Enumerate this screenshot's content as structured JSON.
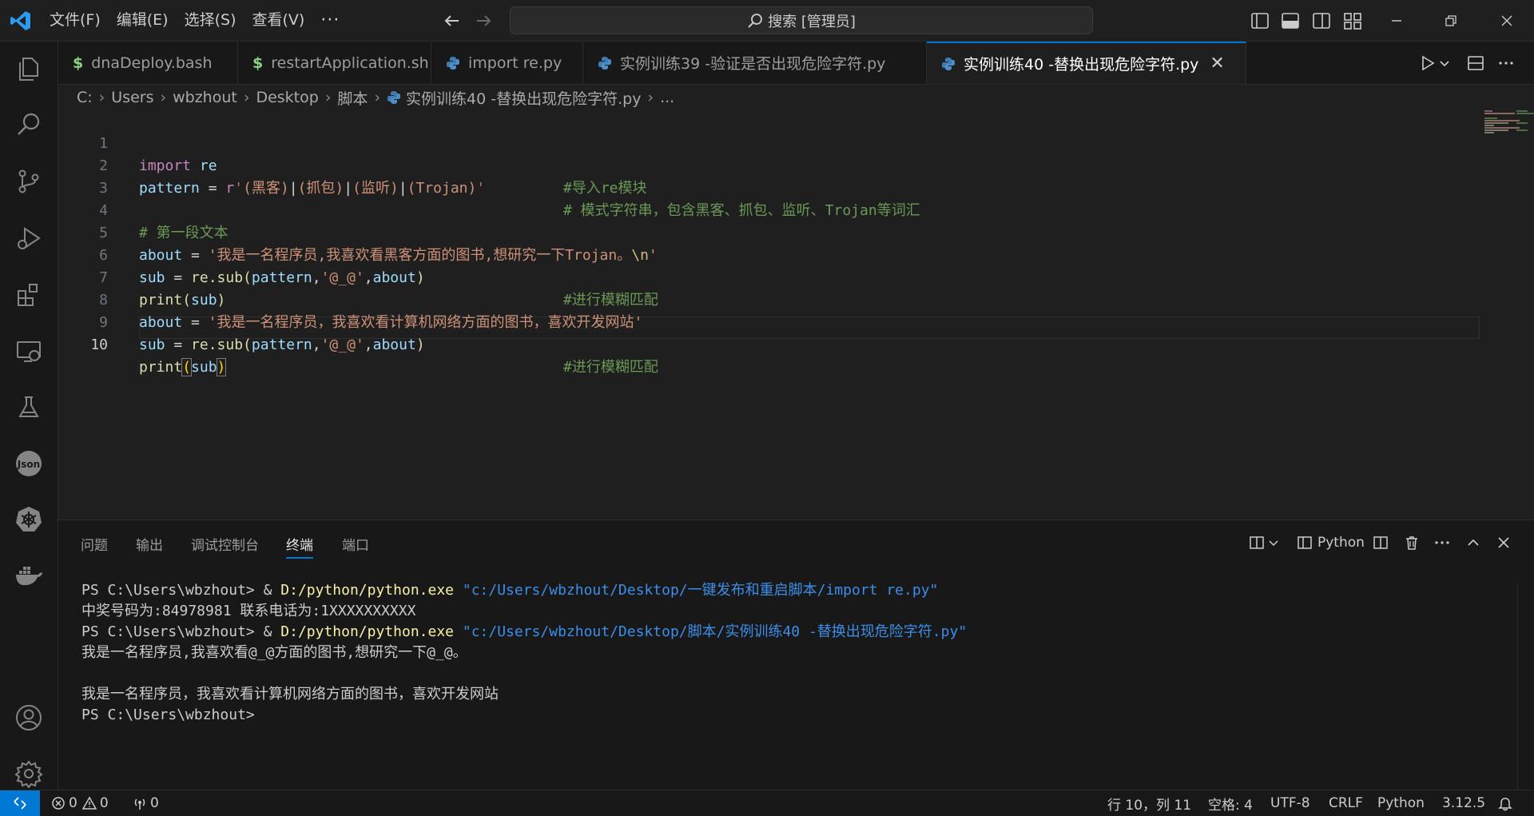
{
  "menu": [
    "文件(F)",
    "编辑(E)",
    "选择(S)",
    "查看(V)",
    "···"
  ],
  "search": {
    "label": "搜索 [管理员]"
  },
  "tabs": [
    {
      "label": "dnaDeploy.bash",
      "icon": "$"
    },
    {
      "label": "restartApplication.sh",
      "icon": "$"
    },
    {
      "label": "import re.py",
      "icon": "python-icon"
    },
    {
      "label": "实例训练39 -验证是否出现危险字符.py",
      "icon": "python-icon"
    },
    {
      "label": "实例训练40 -替换出现危险字符.py",
      "icon": "python-icon",
      "active": true,
      "close": "✕"
    }
  ],
  "breadcrumb": [
    "C:",
    "Users",
    "wbzhout",
    "Desktop",
    "脚本",
    "实例训练40 -替换出现危险字符.py",
    "..."
  ],
  "breadcrumb_sep": "›",
  "editor": {
    "line_numbers": [
      "1",
      "2",
      "3",
      "4",
      "5",
      "6",
      "7",
      "8",
      "9",
      "10"
    ],
    "tokens": {
      "import": "import",
      "re": "re",
      "pattern": "pattern",
      "eq": " = ",
      "r_prefix": "r",
      "regex_q1": "'",
      "rx_g1": "(黑客)",
      "pipe": "|",
      "rx_g2": "(抓包)",
      "rx_g3": "(监听)",
      "rx_g4": "(Trojan)",
      "regex_q2": "'",
      "about": "about",
      "sub": "sub",
      "re_sub": "re.sub(",
      "pattern_arg": "pattern",
      "comma": ",",
      "repl": "'@_@'",
      "about_arg": "about",
      "close_paren": ")",
      "print": "print",
      "open_paren": "(",
      "sub_arg": "sub",
      "str1": "'我是一名程序员,我喜欢看黑客方面的图书,想研究一下Trojan。",
      "esc_n": "\\n",
      "str1_end": "'",
      "str2": "'我是一名程序员，我喜欢看计算机网络方面的图书，喜欢开发网站'",
      "cmt1": "#导入re模块",
      "cmt2": "# 模式字符串，包含黑客、抓包、监听、Trojan等词汇",
      "cmt4": "# 第一段文本",
      "cmt_fuzzy": "#进行模糊匹配"
    }
  },
  "panel": {
    "tabs": [
      "问题",
      "输出",
      "调试控制台",
      "终端",
      "端口"
    ],
    "active_tab": "终端",
    "shell_label": "Python",
    "terminal": {
      "prompt": "PS C:\\Users\\wbzhout> ",
      "amp": "& ",
      "exe": "D:/python/python.exe",
      "arg1": "\"c:/Users/wbzhout/Desktop/一键发布和重启脚本/import re.py\"",
      "out1": "中奖号码为:84978981 联系电话为:1XXXXXXXXXX",
      "arg2": "\"c:/Users/wbzhout/Desktop/脚本/实例训练40 -替换出现危险字符.py\"",
      "out2": "我是一名程序员,我喜欢看@_@方面的图书,想研究一下@_@。",
      "out3": "我是一名程序员，我喜欢看计算机网络方面的图书，喜欢开发网站",
      "final_prompt": "PS C:\\Users\\wbzhout>"
    }
  },
  "status": {
    "errors": "0",
    "warnings": "0",
    "ports": "0",
    "position": "行 10，列 11",
    "spaces": "空格: 4",
    "encoding": "UTF-8",
    "eol": "CRLF",
    "language": "Python",
    "version": "3.12.5"
  },
  "colors": {
    "accent": "#0078d4",
    "background": "#1f1f1f",
    "sidebar": "#181818"
  }
}
